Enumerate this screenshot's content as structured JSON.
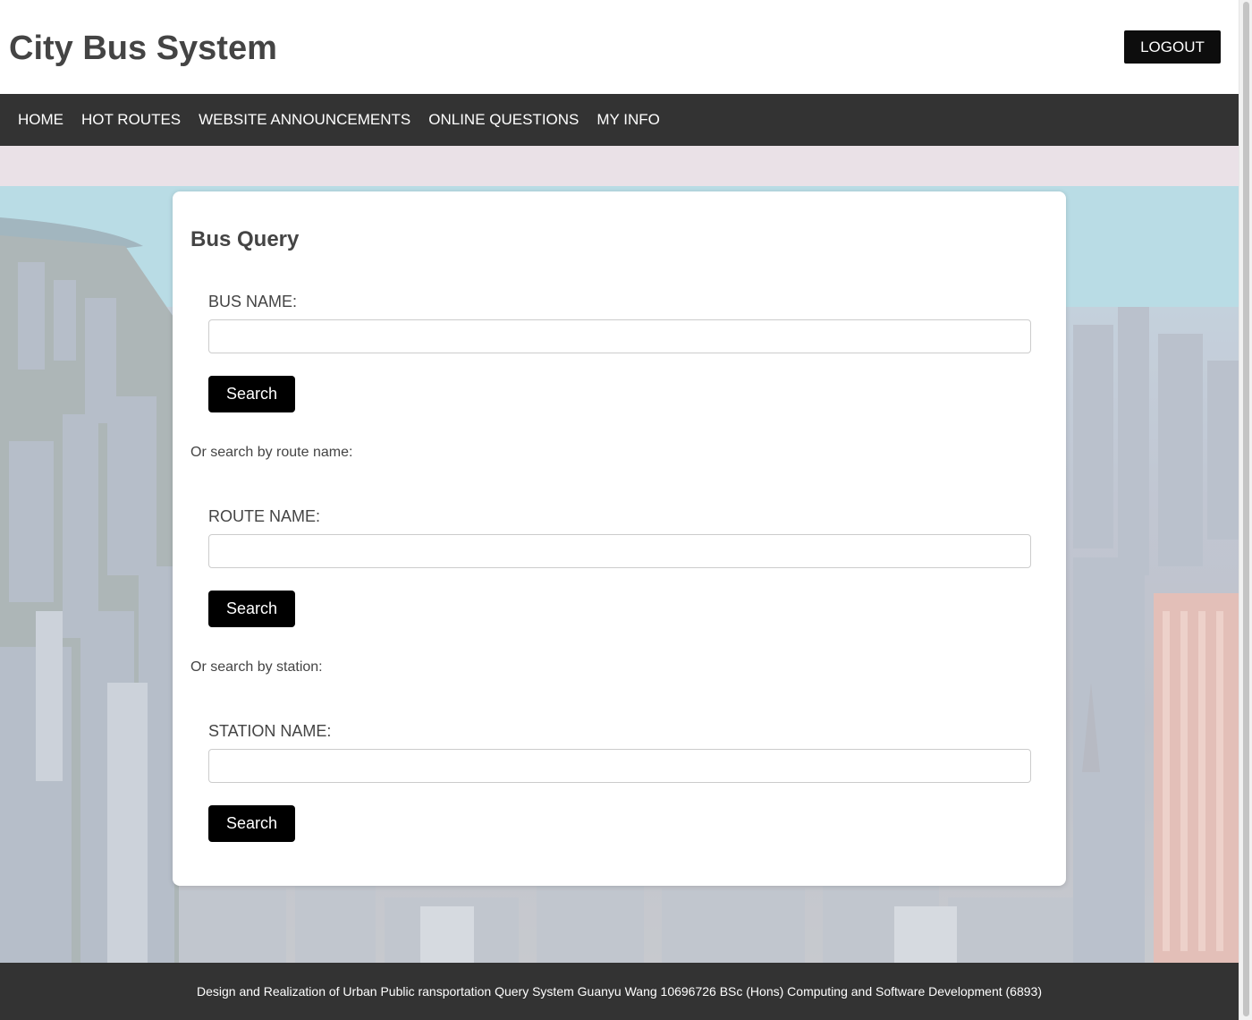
{
  "header": {
    "title": "City Bus System",
    "logout_label": "LOGOUT"
  },
  "nav": {
    "items": [
      {
        "label": "HOME"
      },
      {
        "label": "HOT ROUTES"
      },
      {
        "label": "WEBSITE ANNOUNCEMENTS"
      },
      {
        "label": "ONLINE QUESTIONS"
      },
      {
        "label": "MY INFO"
      }
    ]
  },
  "query": {
    "title": "Bus Query",
    "bus": {
      "label": "BUS NAME:",
      "value": "",
      "button": "Search"
    },
    "route_hint": "Or search by route name:",
    "route": {
      "label": "ROUTE NAME:",
      "value": "",
      "button": "Search"
    },
    "station_hint": "Or search by station:",
    "station": {
      "label": "STATION NAME:",
      "value": "",
      "button": "Search"
    }
  },
  "footer": {
    "text": "Design and Realization of Urban Public ransportation Query System Guanyu Wang 10696726 BSc (Hons) Computing and Software Development (6893)"
  },
  "colors": {
    "nav_bg": "#333333",
    "button_bg": "#000000",
    "text": "#444444"
  }
}
